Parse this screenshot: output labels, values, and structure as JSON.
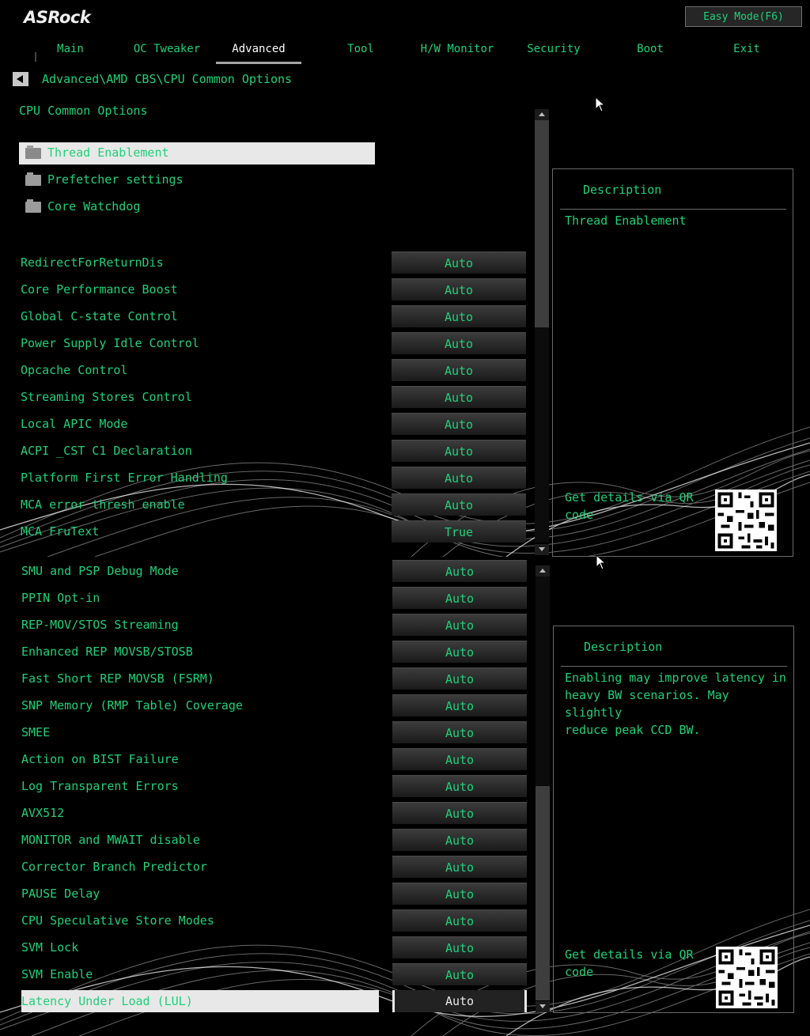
{
  "brand": "ASRock",
  "easy_mode": "Easy Mode(F6)",
  "tabs": [
    {
      "label": "Main"
    },
    {
      "label": "OC Tweaker"
    },
    {
      "label": "Advanced",
      "active": true
    },
    {
      "label": "Tool"
    },
    {
      "label": "H/W Monitor"
    },
    {
      "label": "Security"
    },
    {
      "label": "Boot"
    },
    {
      "label": "Exit"
    }
  ],
  "breadcrumb": "Advanced\\AMD CBS\\CPU Common Options",
  "top": {
    "title": "CPU Common Options",
    "folders": [
      "Thread Enablement",
      "Prefetcher settings",
      "Core Watchdog"
    ],
    "selected_folder": "Thread Enablement",
    "options": [
      {
        "label": "RedirectForReturnDis",
        "value": "Auto"
      },
      {
        "label": "Core Performance Boost",
        "value": "Auto"
      },
      {
        "label": "Global C-state Control",
        "value": "Auto"
      },
      {
        "label": "Power Supply Idle Control",
        "value": "Auto"
      },
      {
        "label": "Opcache Control",
        "value": "Auto"
      },
      {
        "label": "Streaming Stores Control",
        "value": "Auto"
      },
      {
        "label": "Local APIC Mode",
        "value": "Auto"
      },
      {
        "label": "ACPI _CST C1 Declaration",
        "value": "Auto"
      },
      {
        "label": "Platform First Error Handling",
        "value": "Auto"
      },
      {
        "label": "MCA error thresh enable",
        "value": "Auto"
      },
      {
        "label": "MCA FruText",
        "value": "True"
      }
    ],
    "description_title": "Description",
    "description": "Thread Enablement",
    "qr_caption": "Get details via QR code"
  },
  "bottom": {
    "options": [
      {
        "label": "SMU and PSP Debug Mode",
        "value": "Auto"
      },
      {
        "label": "PPIN Opt-in",
        "value": "Auto"
      },
      {
        "label": "REP-MOV/STOS Streaming",
        "value": "Auto"
      },
      {
        "label": "Enhanced REP MOVSB/STOSB",
        "value": "Auto"
      },
      {
        "label": "Fast Short REP MOVSB (FSRM)",
        "value": "Auto"
      },
      {
        "label": "SNP Memory (RMP Table) Coverage",
        "value": "Auto"
      },
      {
        "label": "SMEE",
        "value": "Auto"
      },
      {
        "label": "Action on BIST Failure",
        "value": "Auto"
      },
      {
        "label": "Log Transparent Errors",
        "value": "Auto"
      },
      {
        "label": "AVX512",
        "value": "Auto"
      },
      {
        "label": "MONITOR and MWAIT disable",
        "value": "Auto"
      },
      {
        "label": "Corrector Branch Predictor",
        "value": "Auto"
      },
      {
        "label": "PAUSE Delay",
        "value": "Auto"
      },
      {
        "label": "CPU Speculative Store Modes",
        "value": "Auto"
      },
      {
        "label": "SVM Lock",
        "value": "Auto"
      },
      {
        "label": "SVM Enable",
        "value": "Auto"
      },
      {
        "label": "Latency Under Load (LUL)",
        "value": "Auto",
        "selected": true
      }
    ],
    "description_title": "Description",
    "description": "Enabling may improve latency in\nheavy BW scenarios.  May slightly\nreduce peak CCD BW.",
    "qr_caption": "Get details via QR code"
  },
  "colors": {
    "text_green": "#1fd07a",
    "selection_bg": "#e8e8e8",
    "background": "#000000"
  }
}
